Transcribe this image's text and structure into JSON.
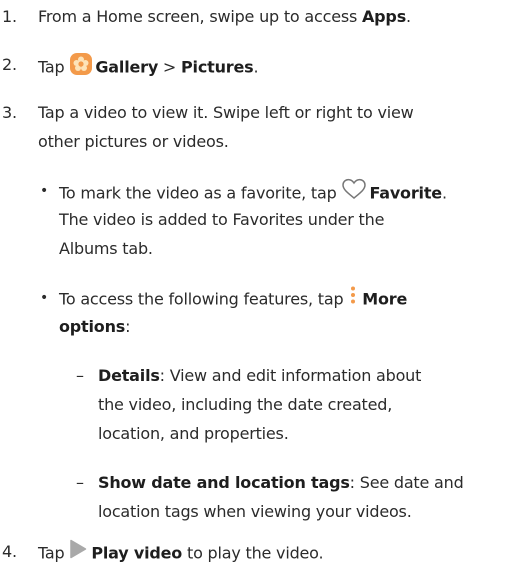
{
  "steps": [
    {
      "number": "1.",
      "pre": "From a Home screen, swipe up to access ",
      "bold": "Apps",
      "post": "."
    },
    {
      "number": "2.",
      "pre": "Tap ",
      "gallery": "Gallery",
      "sep": " > ",
      "pictures": "Pictures",
      "post": "."
    },
    {
      "number": "3.",
      "line1": "Tap a video to view it. Swipe left or right to view",
      "line2": "other pictures or videos.",
      "bullets": [
        {
          "pre": "To mark the video as a favorite, tap ",
          "bold": "Favorite",
          "post": ".",
          "line2": "The video is added to Favorites under the",
          "line3": "Albums tab."
        },
        {
          "pre": "To access the following features, tap ",
          "bold1": "More",
          "bold2": "options",
          "post": ":",
          "subitems": [
            {
              "bold": "Details",
              "text1": ": View and edit information about",
              "text2": "the video, including the date created,",
              "text3": "location, and properties."
            },
            {
              "bold": "Show date and location tags",
              "text1": ": See date and",
              "text2": "location tags when viewing your videos."
            }
          ]
        }
      ]
    },
    {
      "number": "4.",
      "pre": "Tap ",
      "bold": "Play video",
      "post": " to play the video."
    }
  ],
  "colors": {
    "text": "#2b2b2b",
    "gallery_icon": "#f39a4a",
    "play_icon": "#a9a9a9"
  },
  "icons": [
    "gallery-icon",
    "heart-icon",
    "more-options-icon",
    "play-icon"
  ]
}
